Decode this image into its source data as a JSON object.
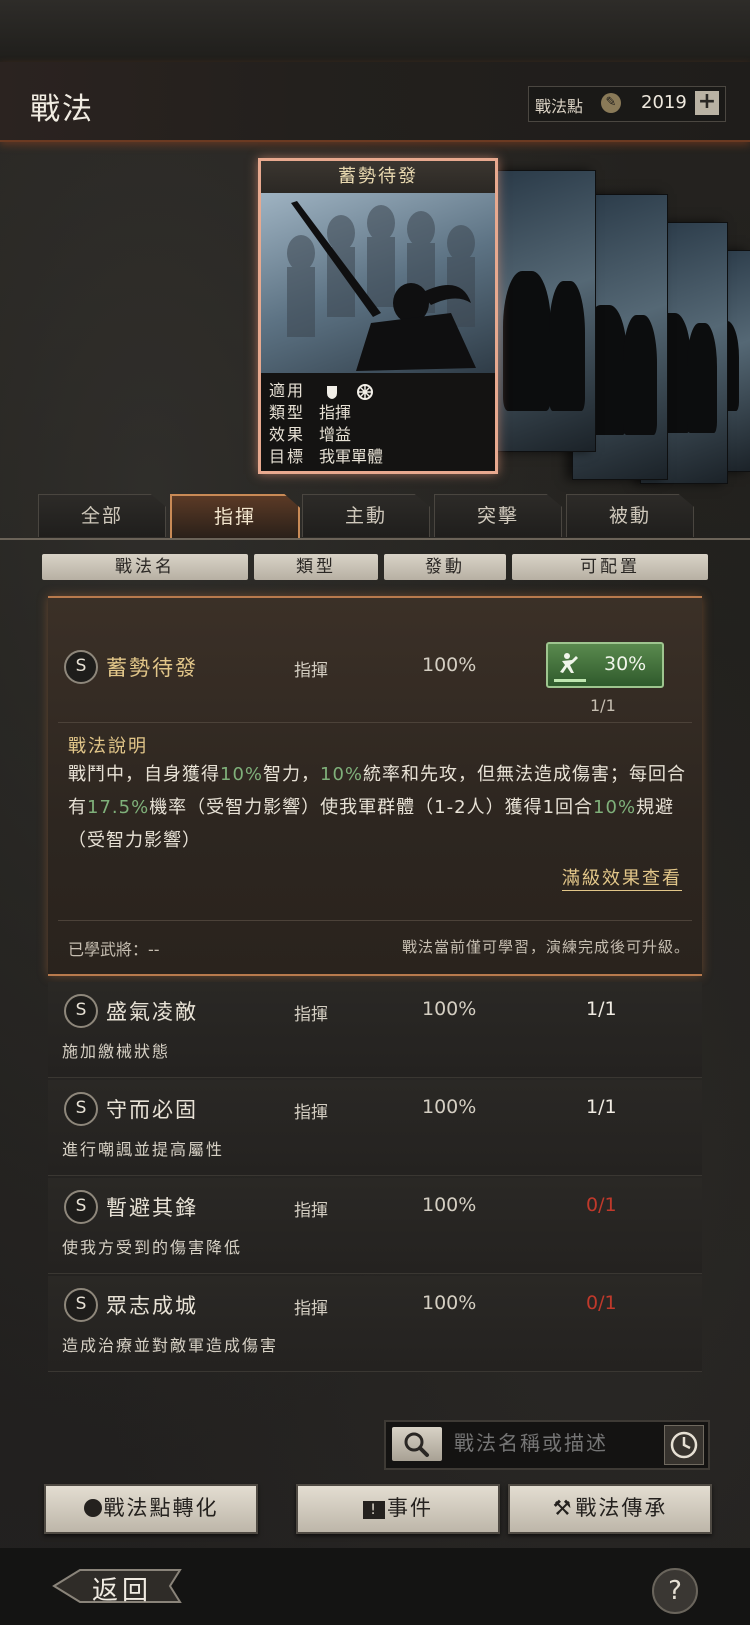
{
  "header": {
    "title": "戰法",
    "points_label": "戰法點",
    "points_value": "2019",
    "add_label": "+"
  },
  "card": {
    "title": "蓄勢待發",
    "meta": [
      {
        "key": "適用",
        "value": ""
      },
      {
        "key": "類型",
        "value": "指揮"
      },
      {
        "key": "效果",
        "value": "增益"
      },
      {
        "key": "目標",
        "value": "我軍單體"
      }
    ]
  },
  "tabs": [
    "全部",
    "指揮",
    "主動",
    "突擊",
    "被動"
  ],
  "active_tab": "指揮",
  "columns": [
    "戰法名",
    "類型",
    "發動",
    "可配置"
  ],
  "expanded": {
    "grade": "S",
    "name": "蓄勢待發",
    "type": "指揮",
    "rate": "100%",
    "equip_value": "30%",
    "count": "1/1",
    "desc_title": "戰法說明",
    "desc_parts": [
      {
        "t": "戰鬥中，自身獲得",
        "hl": false
      },
      {
        "t": "10%",
        "hl": true
      },
      {
        "t": "智力，",
        "hl": false
      },
      {
        "t": "10%",
        "hl": true
      },
      {
        "t": "統率和先攻，但無法造成傷害；每回合有",
        "hl": false
      },
      {
        "t": "17.5%",
        "hl": true
      },
      {
        "t": "機率（受智力影響）使我軍群體（1-2人）獲得1回合",
        "hl": false
      },
      {
        "t": "10%",
        "hl": true
      },
      {
        "t": "規避（受智力影響）",
        "hl": false
      }
    ],
    "view_link": "滿級效果查看",
    "learned": "已學武將：--",
    "hint": "戰法當前僅可學習，演練完成後可升級。"
  },
  "skills": [
    {
      "grade": "S",
      "name": "盛氣凌敵",
      "type": "指揮",
      "rate": "100%",
      "count": "1/1",
      "desc": "施加繳械狀態",
      "available": true
    },
    {
      "grade": "S",
      "name": "守而必固",
      "type": "指揮",
      "rate": "100%",
      "count": "1/1",
      "desc": "進行嘲諷並提高屬性",
      "available": true
    },
    {
      "grade": "S",
      "name": "暫避其鋒",
      "type": "指揮",
      "rate": "100%",
      "count": "0/1",
      "desc": "使我方受到的傷害降低",
      "available": false
    },
    {
      "grade": "S",
      "name": "眾志成城",
      "type": "指揮",
      "rate": "100%",
      "count": "0/1",
      "desc": "造成治療並對敵軍造成傷害",
      "available": false
    }
  ],
  "search": {
    "placeholder": "戰法名稱或描述"
  },
  "buttons": {
    "convert": "戰法點轉化",
    "event": "事件",
    "inherit": "戰法傳承"
  },
  "footer": {
    "back": "返回",
    "help": "?"
  },
  "colors": {
    "accent": "#c98a56",
    "gold": "#e2c689",
    "highlight_green": "#7fb07a",
    "unavailable_red": "#c0392b"
  }
}
